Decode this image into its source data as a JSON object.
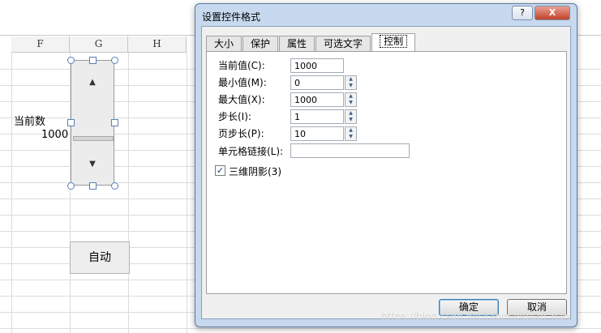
{
  "sheet": {
    "columns": [
      "F",
      "G",
      "H"
    ],
    "cell_label": "当前数",
    "cell_value": "1000",
    "button_label": "自动"
  },
  "dialog": {
    "title": "设置控件格式",
    "help_label": "?",
    "close_label": "X",
    "tabs": [
      {
        "label": "大小",
        "active": false
      },
      {
        "label": "保护",
        "active": false
      },
      {
        "label": "属性",
        "active": false
      },
      {
        "label": "可选文字",
        "active": false
      },
      {
        "label": "控制",
        "active": true
      }
    ],
    "fields": [
      {
        "label": "当前值(C):",
        "value": "1000"
      },
      {
        "label": "最小值(M):",
        "value": "0"
      },
      {
        "label": "最大值(X):",
        "value": "1000"
      },
      {
        "label": "步长(I):",
        "value": "1"
      },
      {
        "label": "页步长(P):",
        "value": "10"
      }
    ],
    "cell_link_label": "单元格链接(L):",
    "cell_link_value": "",
    "shading_label": "三维阴影(3)",
    "shading_checked": true,
    "ok_label": "确定",
    "cancel_label": "取消"
  },
  "watermark": "https://blog.csdn.net/taomangjian_nan"
}
